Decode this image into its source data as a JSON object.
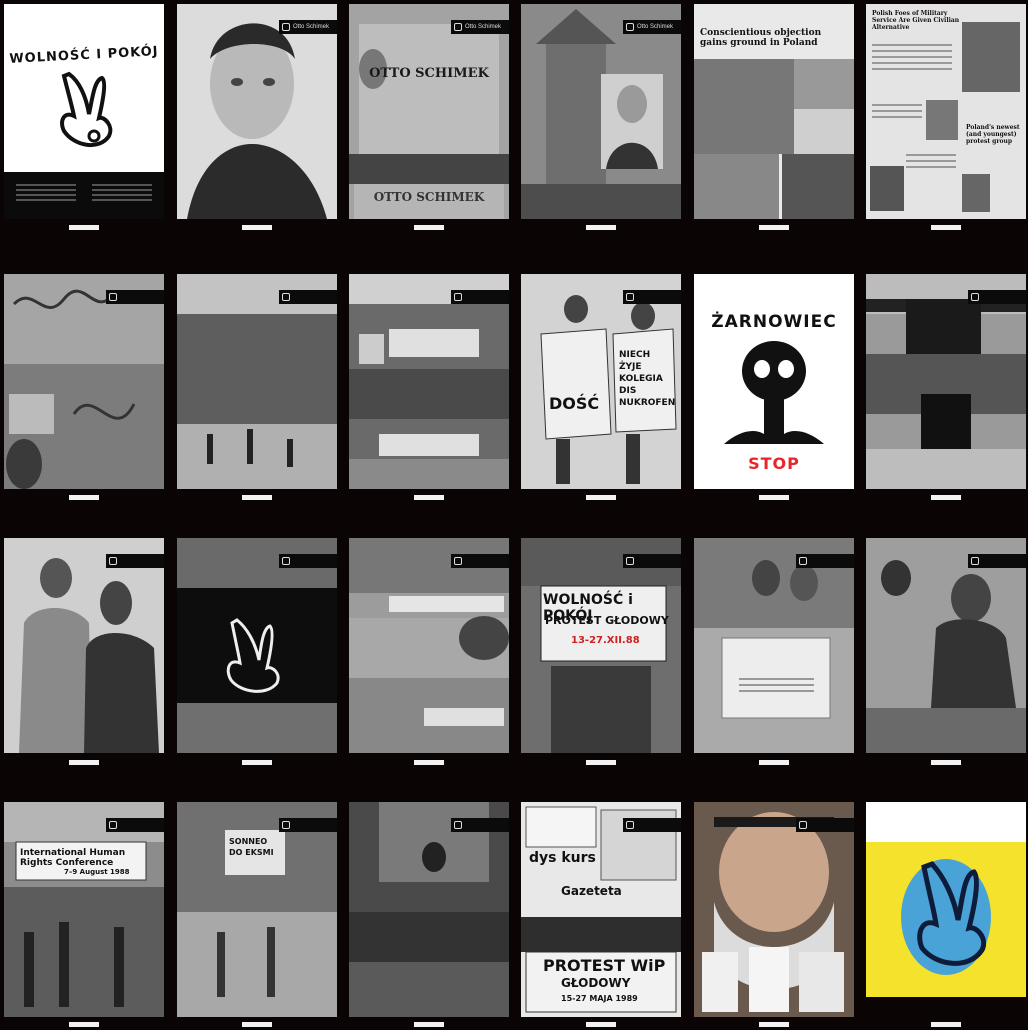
{
  "colors": {
    "background": "#0a0405",
    "poster_white": "#ffffff",
    "poster_yellow": "#f5e22d",
    "poster_blue": "#4aa3d6",
    "stop_red": "#e8262a"
  },
  "icons": [
    "peace-hand-icon",
    "skull-icon",
    "tag-logo-icon"
  ],
  "panels": [
    {
      "tag": "",
      "title": "WOLNOŚĆ I POKÓJ"
    },
    {
      "tag": "Otto Schimek"
    },
    {
      "tag": "Otto Schimek",
      "photo_text": [
        "OTTO SCHIMEK",
        "OTTO SCHIMEK"
      ]
    },
    {
      "tag": "Otto Schimek"
    },
    {
      "tag": "",
      "headline": "Conscientious objection gains ground in Poland"
    },
    {
      "tag": "",
      "headline_1": "Polish Foes of Military Service Are Given Civilian Alternative",
      "headline_2": "Poland's newest (and youngest) protest group"
    },
    {
      "tag": ""
    },
    {
      "tag": ""
    },
    {
      "tag": ""
    },
    {
      "tag": "",
      "signs": [
        "DOŚĆ",
        "NIECH ŻYJE KOLEGIA DIS NUKROFEN"
      ]
    },
    {
      "tag": "",
      "title": "ŻARNOWIEC",
      "subtitle": "STOP"
    },
    {
      "tag": ""
    },
    {
      "tag": ""
    },
    {
      "tag": ""
    },
    {
      "tag": ""
    },
    {
      "tag": "",
      "banner_1": "WOLNOŚĆ i POKÓJ",
      "banner_2": "PROTEST GŁODOWY",
      "banner_3": "13-27.XII.88"
    },
    {
      "tag": ""
    },
    {
      "tag": ""
    },
    {
      "tag": "",
      "banner": "International Human Rights Conference",
      "dates": "7–9 August 1988"
    },
    {
      "tag": "",
      "sign": "SONNEO DO EKSMI"
    },
    {
      "tag": ""
    },
    {
      "tag": "",
      "leaflet_1": "dys kurs",
      "leaflet_2": "Gazeteta",
      "banner_1": "PROTEST WiP",
      "banner_2": "GŁODOWY",
      "dates": "15-27 MAJA 1989"
    },
    {
      "tag": ""
    },
    {
      "tag": ""
    }
  ]
}
